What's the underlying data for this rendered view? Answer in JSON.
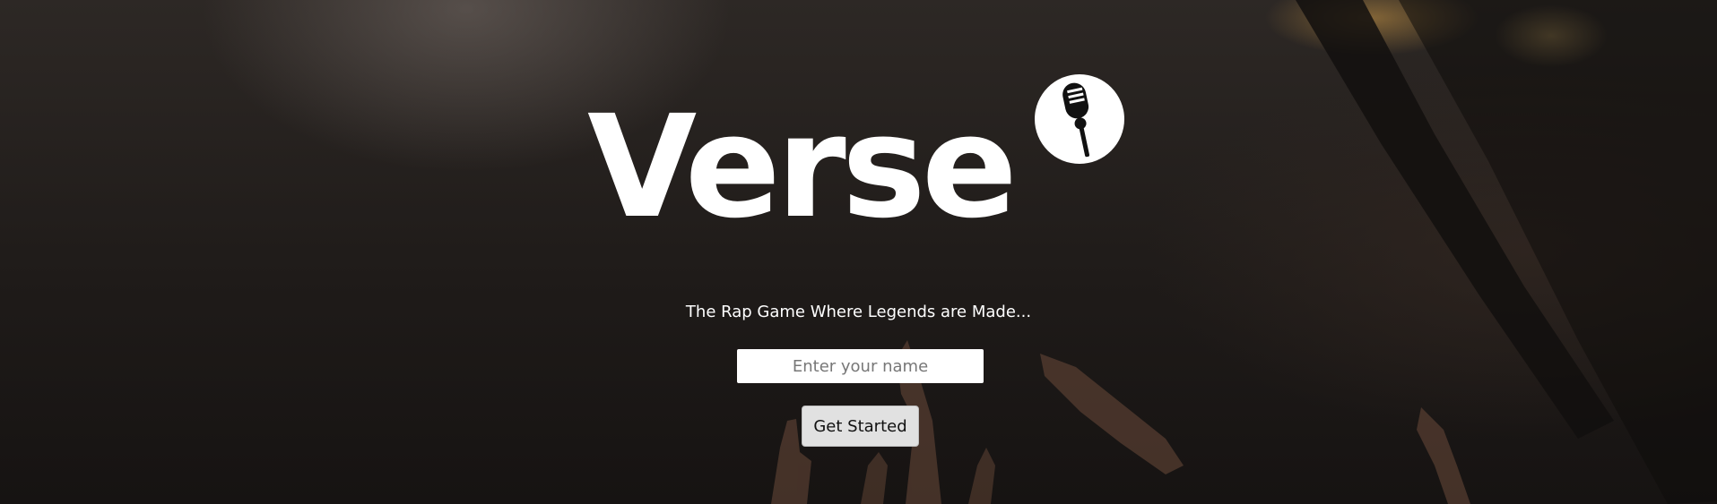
{
  "app": {
    "title": "Verse",
    "logo_icon": "microphone-icon",
    "tagline": "The Rap Game Where Legends are Made..."
  },
  "form": {
    "name_placeholder": "Enter your name",
    "name_value": "",
    "submit_label": "Get Started"
  },
  "colors": {
    "title": "#ffffff",
    "background": "#1f1b19",
    "button_bg": "#e1e1e1",
    "input_bg": "#ffffff"
  }
}
